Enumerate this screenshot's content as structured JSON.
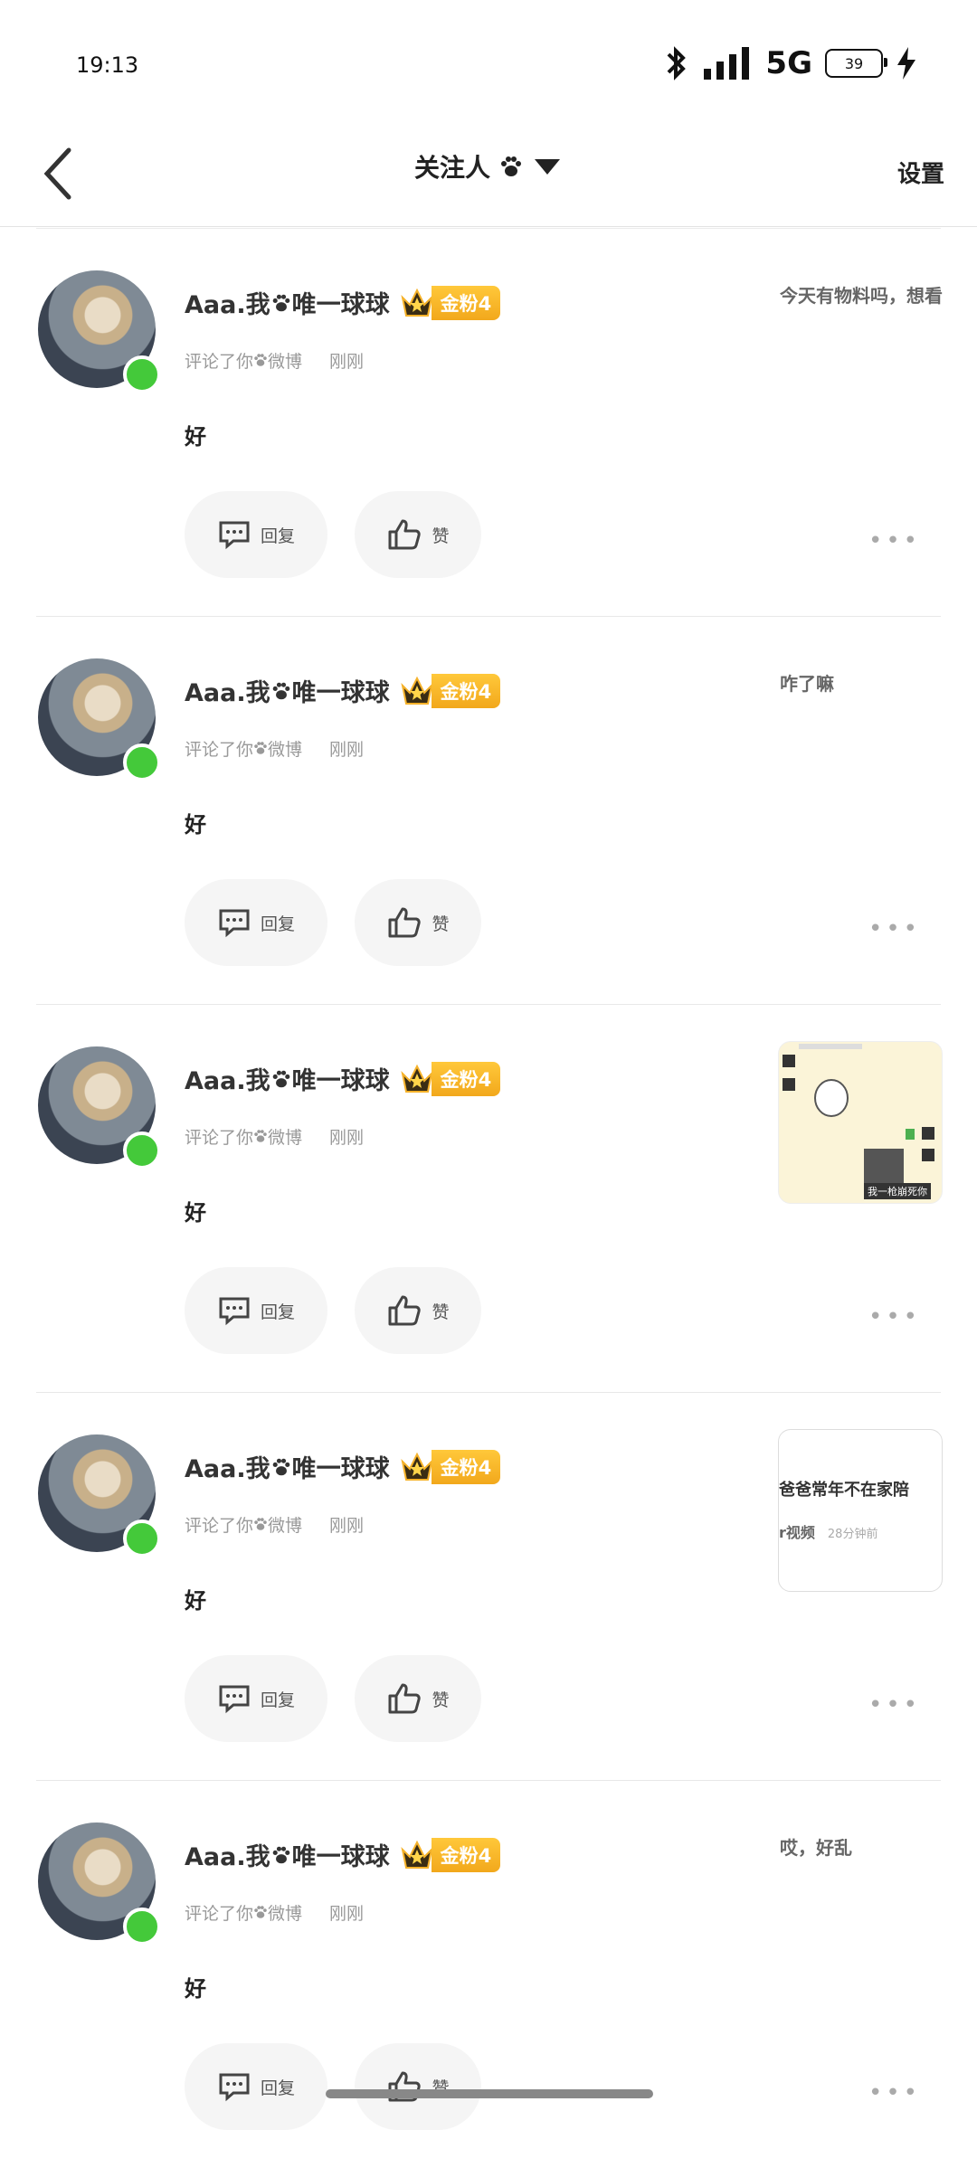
{
  "status_bar": {
    "time": "19:13",
    "network": "5G",
    "battery": "39"
  },
  "nav": {
    "title": "关注人",
    "settings": "设置"
  },
  "items": [
    {
      "name": "Aaa.我",
      "name_suffix": "唯一球球",
      "badge": "金粉4",
      "action": "评论了你",
      "action_suffix": "微博",
      "time": "刚刚",
      "content": "好",
      "reply_label": "回复",
      "like_label": "赞",
      "quote": "今天有物料吗，想看"
    },
    {
      "name": "Aaa.我",
      "name_suffix": "唯一球球",
      "badge": "金粉4",
      "action": "评论了你",
      "action_suffix": "微博",
      "time": "刚刚",
      "content": "好",
      "reply_label": "回复",
      "like_label": "赞",
      "quote": "咋了嘛"
    },
    {
      "name": "Aaa.我",
      "name_suffix": "唯一球球",
      "badge": "金粉4",
      "action": "评论了你",
      "action_suffix": "微博",
      "time": "刚刚",
      "content": "好",
      "reply_label": "回复",
      "like_label": "赞",
      "thumb_caption": "我一枪崩死你"
    },
    {
      "name": "Aaa.我",
      "name_suffix": "唯一球球",
      "badge": "金粉4",
      "action": "评论了你",
      "action_suffix": "微博",
      "time": "刚刚",
      "content": "好",
      "reply_label": "回复",
      "like_label": "赞",
      "thumb_line1": "爸爸常年不在家陪",
      "thumb_line2": "r视频",
      "thumb_line2_time": "28分钟前"
    },
    {
      "name": "Aaa.我",
      "name_suffix": "唯一球球",
      "badge": "金粉4",
      "action": "评论了你",
      "action_suffix": "微博",
      "time": "刚刚",
      "content": "好",
      "reply_label": "回复",
      "like_label": "赞",
      "quote": "哎，好乱"
    }
  ],
  "colors": {
    "online": "#44c93a",
    "badge": "#f5b22a"
  }
}
